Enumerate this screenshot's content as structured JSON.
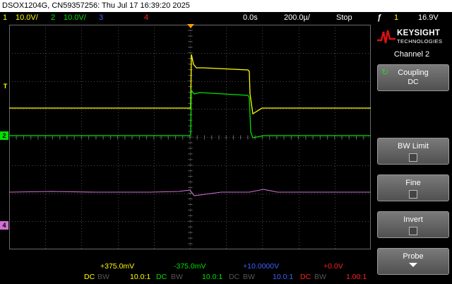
{
  "titlebar": {
    "text": "DSOX1204G, CN59357256: Thu Jul 17 16:39:20 2025"
  },
  "status": {
    "ch1_num": "1",
    "ch1_scale": "10.0V/",
    "ch2_num": "2",
    "ch2_scale": "10.0V/",
    "ch3_num": "3",
    "ch4_num": "4",
    "time_delay": "0.0s",
    "time_scale": "200.0µ/",
    "run_state": "Stop",
    "trigger_icon": "ƒ",
    "trigger_ch": "1",
    "trigger_level": "16.9V"
  },
  "side": {
    "brand": "KEYSIGHT",
    "tech": "TECHNOLOGIES",
    "menu_title": "Channel 2",
    "softkeys": [
      {
        "label": "Coupling",
        "value": "DC"
      },
      {
        "label": "BW Limit"
      },
      {
        "label": "Fine"
      },
      {
        "label": "Invert"
      },
      {
        "label": "Probe"
      }
    ]
  },
  "markers": {
    "trigger": "T",
    "ch2": "2",
    "ch4": "4"
  },
  "bottom": {
    "offsets": [
      "+375.0mV",
      "-375.0mV",
      "+10.0000V",
      "+0.0V"
    ],
    "coupling": [
      "DC",
      "DC",
      "DC",
      "DC"
    ],
    "bw": [
      "BW",
      "BW",
      "BW",
      "BW"
    ],
    "probe": [
      "10.0:1",
      "10.0:1",
      "10.0:1",
      "1.00:1"
    ]
  },
  "colors": {
    "ch1": "#ffff00",
    "ch2": "#00e000",
    "ch3": "#4060ff",
    "ch4": "#ff2020",
    "math": "#d070d0",
    "grid": "#4a4a4a",
    "trigger_marker": "#ff9900"
  }
}
